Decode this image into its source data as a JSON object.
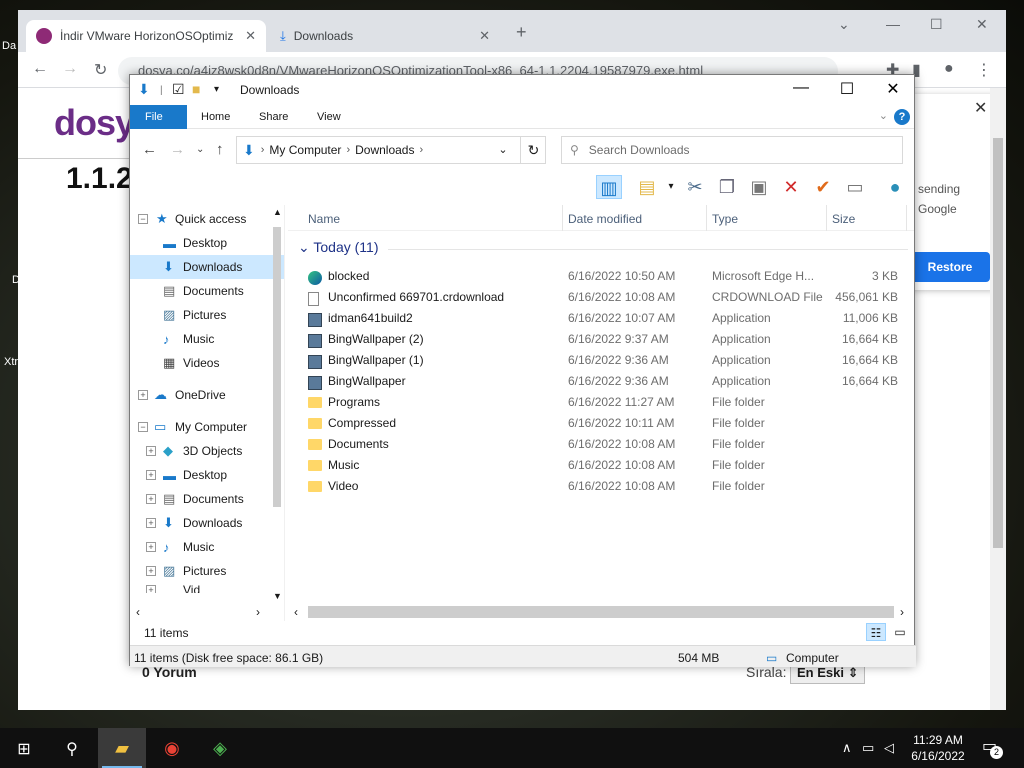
{
  "desktop": {
    "fragments": [
      "Da",
      "D",
      "Xtr"
    ]
  },
  "browser": {
    "tabs": [
      {
        "title": "İndir VMware HorizonOSOptimiz",
        "active": true
      },
      {
        "title": "Downloads",
        "active": false
      }
    ],
    "new_tab_glyph": "+",
    "url": "dosya.co/a4iz8wsk0d8n/VMwareHorizonOSOptimizationTool-x86_64-1.1.2204.19587979.exe.html",
    "page": {
      "brand": "dosya",
      "version_fragment": "1.1.2",
      "comments": "0 Yorum",
      "sort_label": "Sırala:",
      "sort_value": "En Eski",
      "popup": {
        "line1": "sending",
        "line2": "Google",
        "restore_label": "Restore"
      }
    }
  },
  "explorer": {
    "title": "Downloads",
    "ribbon_tabs": [
      "File",
      "Home",
      "Share",
      "View"
    ],
    "help_glyph": "?",
    "address": {
      "root": "My Computer",
      "folder": "Downloads"
    },
    "search_placeholder": "Search Downloads",
    "columns": {
      "name": "Name",
      "date": "Date modified",
      "type": "Type",
      "size": "Size"
    },
    "group": "Today (11)",
    "files": [
      {
        "name": "blocked",
        "date": "6/16/2022 10:50 AM",
        "type": "Microsoft Edge H...",
        "size": "3 KB",
        "icon": "edge-icon"
      },
      {
        "name": "Unconfirmed 669701.crdownload",
        "date": "6/16/2022 10:08 AM",
        "type": "CRDOWNLOAD File",
        "size": "456,061 KB",
        "icon": "file-icon"
      },
      {
        "name": "idman641build2",
        "date": "6/16/2022 10:07 AM",
        "type": "Application",
        "size": "11,006 KB",
        "icon": "app-icon"
      },
      {
        "name": "BingWallpaper (2)",
        "date": "6/16/2022 9:37 AM",
        "type": "Application",
        "size": "16,664 KB",
        "icon": "app-icon"
      },
      {
        "name": "BingWallpaper (1)",
        "date": "6/16/2022 9:36 AM",
        "type": "Application",
        "size": "16,664 KB",
        "icon": "app-icon"
      },
      {
        "name": "BingWallpaper",
        "date": "6/16/2022 9:36 AM",
        "type": "Application",
        "size": "16,664 KB",
        "icon": "app-icon"
      },
      {
        "name": "Programs",
        "date": "6/16/2022 11:27 AM",
        "type": "File folder",
        "size": "",
        "icon": "folder-icon"
      },
      {
        "name": "Compressed",
        "date": "6/16/2022 10:11 AM",
        "type": "File folder",
        "size": "",
        "icon": "folder-icon"
      },
      {
        "name": "Documents",
        "date": "6/16/2022 10:08 AM",
        "type": "File folder",
        "size": "",
        "icon": "folder-icon"
      },
      {
        "name": "Music",
        "date": "6/16/2022 10:08 AM",
        "type": "File folder",
        "size": "",
        "icon": "folder-icon"
      },
      {
        "name": "Video",
        "date": "6/16/2022 10:08 AM",
        "type": "File folder",
        "size": "",
        "icon": "folder-icon"
      }
    ],
    "nav": {
      "quick_access": "Quick access",
      "qa_items": [
        "Desktop",
        "Downloads",
        "Documents",
        "Pictures",
        "Music",
        "Videos"
      ],
      "onedrive": "OneDrive",
      "my_computer": "My Computer",
      "pc_items": [
        "3D Objects",
        "Desktop",
        "Documents",
        "Downloads",
        "Music",
        "Pictures",
        "Vid"
      ]
    },
    "status": {
      "items": "11 items"
    },
    "info": {
      "summary": "11 items (Disk free space: 86.1 GB)",
      "size": "504 MB",
      "location": "Computer"
    }
  },
  "taskbar": {
    "time": "11:29 AM",
    "date": "6/16/2022",
    "notifications": "2"
  }
}
